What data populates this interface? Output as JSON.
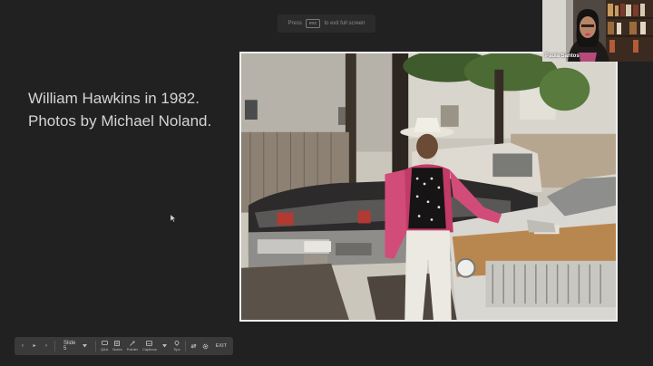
{
  "fullscreen_hint": {
    "press": "Press",
    "key": "esc",
    "rest": "to exit full screen"
  },
  "slide": {
    "line1": "William Hawkins in 1982.",
    "line2": "Photos by Michael Noland."
  },
  "participant": {
    "name": "Paula Santos"
  },
  "toolbar": {
    "prev_icon": "‹",
    "play_icon": "▸",
    "next_icon": "›",
    "slide_label": "Slide 5",
    "qa_label": "Q&A",
    "notes_label": "Notes",
    "pointer_label": "Pointer",
    "captions_label": "Captions",
    "tips_label": "Tips",
    "exit_label": "EXIT"
  },
  "colors": {
    "background": "#212121",
    "slide_text": "#d4d4d4",
    "toolbar": "#3a3a3a",
    "jacket_sleeve": "#d24c7a"
  },
  "icons": [
    "chevron-left-icon",
    "play-icon",
    "chevron-right-icon",
    "chevron-down-icon",
    "qa-icon",
    "notes-icon",
    "pointer-icon",
    "captions-icon",
    "tips-icon",
    "swap-icon",
    "gear-icon"
  ]
}
